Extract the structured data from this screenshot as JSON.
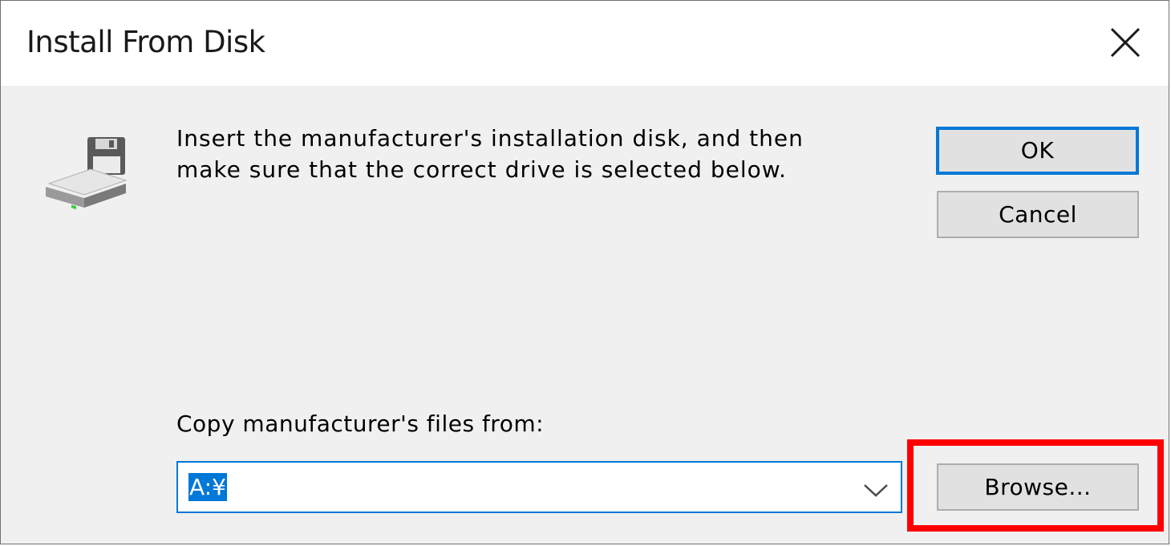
{
  "window": {
    "title": "Install From Disk"
  },
  "icons": {
    "close": "close-icon",
    "drive": "drive-icon",
    "dropdown": "chevron-down-icon"
  },
  "message": {
    "text": "Insert the manufacturer's installation disk, and then\nmake sure that the correct drive is selected below."
  },
  "buttons": {
    "ok_label": "OK",
    "cancel_label": "Cancel",
    "browse_label": "Browse..."
  },
  "copy_from": {
    "label": "Copy manufacturer's files from:",
    "value": "A:¥"
  },
  "colors": {
    "accent": "#0078d7",
    "annotation": "#ff0000",
    "dialog_bg": "#f0f0f0",
    "button_bg": "#e1e1e1"
  }
}
